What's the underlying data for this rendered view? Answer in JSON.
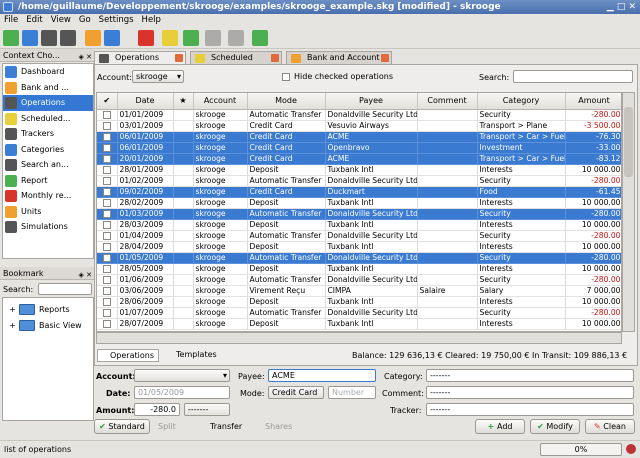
{
  "window": {
    "title": "/home/guillaume/Developpement/skrooge/examples/skrooge_example.skg [modified] - skrooge"
  },
  "menu": [
    "File",
    "Edit",
    "View",
    "Go",
    "Settings",
    "Help"
  ],
  "context": {
    "title": "Context Cho...",
    "items": [
      {
        "label": "Dashboard",
        "icon": "dashboard-icon"
      },
      {
        "label": "Bank and ...",
        "icon": "bank-icon"
      },
      {
        "label": "Operations",
        "icon": "operations-icon",
        "selected": true
      },
      {
        "label": "Scheduled...",
        "icon": "clock-icon"
      },
      {
        "label": "Trackers",
        "icon": "tracker-icon"
      },
      {
        "label": "Categories",
        "icon": "categories-icon"
      },
      {
        "label": "Search an...",
        "icon": "binoculars-icon"
      },
      {
        "label": "Report",
        "icon": "report-icon"
      },
      {
        "label": "Monthly re...",
        "icon": "calendar-icon"
      },
      {
        "label": "Units",
        "icon": "units-icon"
      },
      {
        "label": "Simulations",
        "icon": "calculator-icon"
      }
    ]
  },
  "bookmark": {
    "title": "Bookmark",
    "search_label": "Search:",
    "items": [
      {
        "label": "Reports"
      },
      {
        "label": "Basic View"
      }
    ]
  },
  "tabs": [
    {
      "label": "Operations",
      "active": true
    },
    {
      "label": "Scheduled",
      "active": false
    },
    {
      "label": "Bank and Account",
      "active": false
    }
  ],
  "filter": {
    "account_label": "Account:",
    "account_value": "skrooge",
    "hide_checked_label": "Hide checked operations",
    "search_label": "Search:"
  },
  "columns": [
    "",
    "Date",
    "",
    "Account",
    "Mode",
    "Payee",
    "Comment",
    "Category",
    "Amount"
  ],
  "rows": [
    {
      "date": "01/01/2009",
      "account": "skrooge",
      "mode": "Automatic Transfer",
      "payee": "Donaldville Security Ltd",
      "comment": "",
      "category": "Security",
      "amount": "-280.00",
      "neg": true,
      "sel": false
    },
    {
      "date": "03/01/2009",
      "account": "skrooge",
      "mode": "Credit Card",
      "payee": "Vesuvio Airways",
      "comment": "",
      "category": "Transport > Plane",
      "amount": "-3 500.00",
      "neg": true,
      "sel": false
    },
    {
      "date": "06/01/2009",
      "account": "skrooge",
      "mode": "Credit Card",
      "payee": "ACME",
      "comment": "",
      "category": "Transport > Car > Fuel",
      "amount": "-76.30",
      "neg": true,
      "sel": true
    },
    {
      "date": "06/01/2009",
      "account": "skrooge",
      "mode": "Credit Card",
      "payee": "Openbravo",
      "comment": "",
      "category": "Investment",
      "amount": "-33.00",
      "neg": true,
      "sel": true
    },
    {
      "date": "20/01/2009",
      "account": "skrooge",
      "mode": "Credit Card",
      "payee": "ACME",
      "comment": "",
      "category": "Transport > Car > Fuel",
      "amount": "-83.12",
      "neg": true,
      "sel": true
    },
    {
      "date": "28/01/2009",
      "account": "skrooge",
      "mode": "Deposit",
      "payee": "Tuxbank Intl",
      "comment": "",
      "category": "Interests",
      "amount": "10 000.00",
      "neg": false,
      "sel": false
    },
    {
      "date": "01/02/2009",
      "account": "skrooge",
      "mode": "Automatic Transfer",
      "payee": "Donaldville Security Ltd",
      "comment": "",
      "category": "Security",
      "amount": "-280.00",
      "neg": true,
      "sel": false
    },
    {
      "date": "09/02/2009",
      "account": "skrooge",
      "mode": "Credit Card",
      "payee": "Duckmart",
      "comment": "",
      "category": "Food",
      "amount": "-61.45",
      "neg": true,
      "sel": true
    },
    {
      "date": "28/02/2009",
      "account": "skrooge",
      "mode": "Deposit",
      "payee": "Tuxbank Intl",
      "comment": "",
      "category": "Interests",
      "amount": "10 000.00",
      "neg": false,
      "sel": false
    },
    {
      "date": "01/03/2009",
      "account": "skrooge",
      "mode": "Automatic Transfer",
      "payee": "Donaldville Security Ltd",
      "comment": "",
      "category": "Security",
      "amount": "-280.00",
      "neg": true,
      "sel": true
    },
    {
      "date": "28/03/2009",
      "account": "skrooge",
      "mode": "Deposit",
      "payee": "Tuxbank Intl",
      "comment": "",
      "category": "Interests",
      "amount": "10 000.00",
      "neg": false,
      "sel": false
    },
    {
      "date": "01/04/2009",
      "account": "skrooge",
      "mode": "Automatic Transfer",
      "payee": "Donaldville Security Ltd",
      "comment": "",
      "category": "Security",
      "amount": "-280.00",
      "neg": true,
      "sel": false
    },
    {
      "date": "28/04/2009",
      "account": "skrooge",
      "mode": "Deposit",
      "payee": "Tuxbank Intl",
      "comment": "",
      "category": "Interests",
      "amount": "10 000.00",
      "neg": false,
      "sel": false
    },
    {
      "date": "01/05/2009",
      "account": "skrooge",
      "mode": "Automatic Transfer",
      "payee": "Donaldville Security Ltd",
      "comment": "",
      "category": "Security",
      "amount": "-280.00",
      "neg": true,
      "sel": true
    },
    {
      "date": "28/05/2009",
      "account": "skrooge",
      "mode": "Deposit",
      "payee": "Tuxbank Intl",
      "comment": "",
      "category": "Interests",
      "amount": "10 000.00",
      "neg": false,
      "sel": false
    },
    {
      "date": "01/06/2009",
      "account": "skrooge",
      "mode": "Automatic Transfer",
      "payee": "Donaldville Security Ltd",
      "comment": "",
      "category": "Security",
      "amount": "-280.00",
      "neg": true,
      "sel": false
    },
    {
      "date": "03/06/2009",
      "account": "skrooge",
      "mode": "Virement Reçu",
      "payee": "CIMPA",
      "comment": "Salaire",
      "category": "Salary",
      "amount": "7 000.00",
      "neg": false,
      "sel": false
    },
    {
      "date": "28/06/2009",
      "account": "skrooge",
      "mode": "Deposit",
      "payee": "Tuxbank Intl",
      "comment": "",
      "category": "Interests",
      "amount": "10 000.00",
      "neg": false,
      "sel": false
    },
    {
      "date": "01/07/2009",
      "account": "skrooge",
      "mode": "Automatic Transfer",
      "payee": "Donaldville Security Ltd",
      "comment": "",
      "category": "Security",
      "amount": "-280.00",
      "neg": true,
      "sel": false
    },
    {
      "date": "28/07/2009",
      "account": "skrooge",
      "mode": "Deposit",
      "payee": "Tuxbank Intl",
      "comment": "",
      "category": "Interests",
      "amount": "10 000.00",
      "neg": false,
      "sel": false
    }
  ],
  "subtabs": [
    "Operations",
    "Templates"
  ],
  "balance_text": "Balance: 129 636,13 € Cleared: 19 750,00 € In Transit: 109 886,13 €",
  "editor": {
    "account_label": "Account:",
    "account_value": "",
    "date_label": "Date:",
    "date_value": "01/05/2009",
    "amount_label": "Amount:",
    "amount_value": "-280.0",
    "amount_unit": "-------",
    "payee_label": "Payee:",
    "payee_value": "ACME",
    "mode_label": "Mode:",
    "mode_value": "Credit Card",
    "number_placeholder": "Number",
    "category_label": "Category:",
    "category_value": "-------",
    "comment_label": "Comment:",
    "comment_value": "-------",
    "tracker_label": "Tracker:",
    "tracker_value": "-------"
  },
  "buttons": {
    "standard": "Standard",
    "split": "Split",
    "transfer": "Transfer",
    "shares": "Shares",
    "add": "Add",
    "modify": "Modify",
    "clean": "Clean"
  },
  "status": {
    "text": "list of operations",
    "progress": "0%"
  }
}
